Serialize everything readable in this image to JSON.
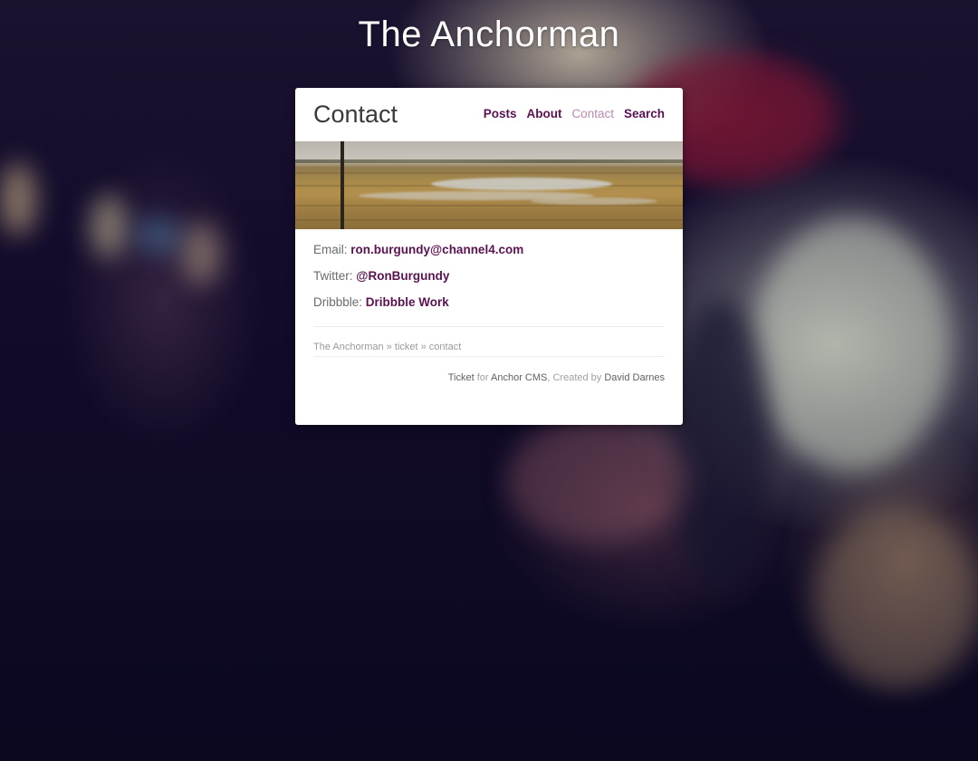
{
  "site": {
    "title": "The Anchorman"
  },
  "page": {
    "title": "Contact"
  },
  "nav": {
    "items": [
      {
        "label": "Posts",
        "active": false
      },
      {
        "label": "About",
        "active": false
      },
      {
        "label": "Contact",
        "active": true
      },
      {
        "label": "Search",
        "active": false
      }
    ]
  },
  "contact": {
    "email_label": "Email:",
    "email_value": "ron.burgundy@channel4.com",
    "twitter_label": "Twitter:",
    "twitter_value": "@RonBurgundy",
    "dribbble_label": "Dribbble:",
    "dribbble_value": "Dribbble Work"
  },
  "breadcrumb": {
    "text": "The Anchorman » ticket » contact"
  },
  "footer": {
    "theme_link": "Ticket",
    "for_text": " for ",
    "cms_link": "Anchor CMS",
    "created_text": ", Created by ",
    "author_link": "David Darnes"
  },
  "colors": {
    "link": "#5a1251",
    "link_active": "#b88ab0",
    "card_bg": "#ffffff"
  }
}
